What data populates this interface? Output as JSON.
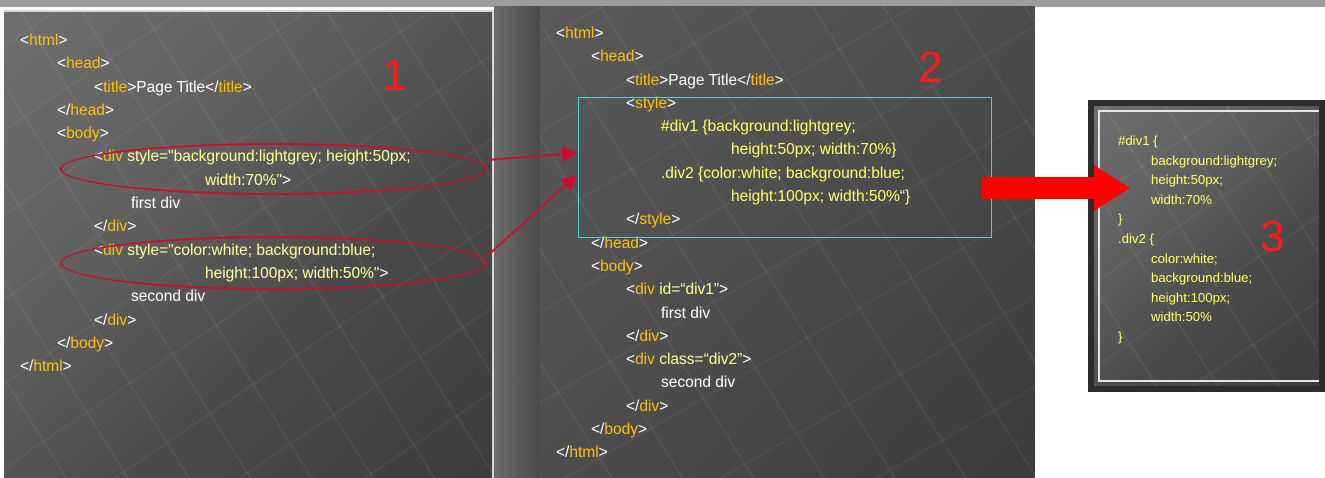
{
  "panel1": {
    "number": "1",
    "lines": [
      {
        "indent": 0,
        "parts": [
          {
            "cls": "txt",
            "t": "<"
          },
          {
            "cls": "tag",
            "t": "html"
          },
          {
            "cls": "txt",
            "t": ">"
          }
        ]
      },
      {
        "indent": 1,
        "parts": [
          {
            "cls": "txt",
            "t": "<"
          },
          {
            "cls": "tag",
            "t": "head"
          },
          {
            "cls": "txt",
            "t": ">"
          }
        ]
      },
      {
        "indent": 2,
        "parts": [
          {
            "cls": "txt",
            "t": "<"
          },
          {
            "cls": "tag",
            "t": "title"
          },
          {
            "cls": "txt",
            "t": ">Page Title</"
          },
          {
            "cls": "tag",
            "t": "title"
          },
          {
            "cls": "txt",
            "t": ">"
          }
        ]
      },
      {
        "indent": 1,
        "parts": [
          {
            "cls": "txt",
            "t": "</"
          },
          {
            "cls": "tag",
            "t": "head"
          },
          {
            "cls": "txt",
            "t": ">"
          }
        ]
      },
      {
        "indent": 1,
        "parts": [
          {
            "cls": "txt",
            "t": "<"
          },
          {
            "cls": "tag",
            "t": "body"
          },
          {
            "cls": "txt",
            "t": ">"
          }
        ]
      },
      {
        "indent": 2,
        "parts": [
          {
            "cls": "txt",
            "t": "<"
          },
          {
            "cls": "tag",
            "t": "div"
          },
          {
            "cls": "attr",
            "t": " style=\"background:lightgrey; height:50px;"
          }
        ]
      },
      {
        "indent": 5,
        "parts": [
          {
            "cls": "attr",
            "t": "width:70%\""
          },
          {
            "cls": "txt",
            "t": ">"
          }
        ]
      },
      {
        "indent": 3,
        "parts": [
          {
            "cls": "txt",
            "t": "first div"
          }
        ]
      },
      {
        "indent": 2,
        "parts": [
          {
            "cls": "txt",
            "t": "</"
          },
          {
            "cls": "tag",
            "t": "div"
          },
          {
            "cls": "txt",
            "t": ">"
          }
        ]
      },
      {
        "indent": 2,
        "parts": [
          {
            "cls": "txt",
            "t": "<"
          },
          {
            "cls": "tag",
            "t": "div"
          },
          {
            "cls": "attr",
            "t": " style=\"color:white; background:blue;"
          }
        ]
      },
      {
        "indent": 5,
        "parts": [
          {
            "cls": "attr",
            "t": "height:100px; width:50%\""
          },
          {
            "cls": "txt",
            "t": ">"
          }
        ]
      },
      {
        "indent": 3,
        "parts": [
          {
            "cls": "txt",
            "t": "second div"
          }
        ]
      },
      {
        "indent": 2,
        "parts": [
          {
            "cls": "txt",
            "t": "</"
          },
          {
            "cls": "tag",
            "t": "div"
          },
          {
            "cls": "txt",
            "t": ">"
          }
        ]
      },
      {
        "indent": 1,
        "parts": [
          {
            "cls": "txt",
            "t": "</"
          },
          {
            "cls": "tag",
            "t": "body"
          },
          {
            "cls": "txt",
            "t": ">"
          }
        ]
      },
      {
        "indent": 0,
        "parts": [
          {
            "cls": "txt",
            "t": "</"
          },
          {
            "cls": "tag",
            "t": "html"
          },
          {
            "cls": "txt",
            "t": ">"
          }
        ]
      }
    ]
  },
  "panel2": {
    "number": "2",
    "lines": [
      {
        "indent": 0,
        "parts": [
          {
            "cls": "txt",
            "t": "<"
          },
          {
            "cls": "tag",
            "t": "html"
          },
          {
            "cls": "txt",
            "t": ">"
          }
        ]
      },
      {
        "indent": 1,
        "parts": [
          {
            "cls": "txt",
            "t": "<"
          },
          {
            "cls": "tag",
            "t": "head"
          },
          {
            "cls": "txt",
            "t": ">"
          }
        ]
      },
      {
        "indent": 2,
        "parts": [
          {
            "cls": "txt",
            "t": "<"
          },
          {
            "cls": "tag",
            "t": "title"
          },
          {
            "cls": "txt",
            "t": ">Page Title</"
          },
          {
            "cls": "tag",
            "t": "title"
          },
          {
            "cls": "txt",
            "t": ">"
          }
        ]
      },
      {
        "indent": 2,
        "parts": [
          {
            "cls": "txt",
            "t": "<"
          },
          {
            "cls": "tag",
            "t": "style"
          },
          {
            "cls": "txt",
            "t": ">"
          }
        ]
      },
      {
        "indent": 3,
        "parts": [
          {
            "cls": "css",
            "t": "#div1 {background:lightgrey;"
          }
        ]
      },
      {
        "indent": 5,
        "parts": [
          {
            "cls": "css",
            "t": "height:50px; width:70%}"
          }
        ]
      },
      {
        "indent": 3,
        "parts": [
          {
            "cls": "css",
            "t": ".div2 {color:white; background:blue;"
          }
        ]
      },
      {
        "indent": 5,
        "parts": [
          {
            "cls": "css",
            "t": "height:100px; width:50%“}"
          }
        ]
      },
      {
        "indent": 2,
        "parts": [
          {
            "cls": "txt",
            "t": "</"
          },
          {
            "cls": "tag",
            "t": "style"
          },
          {
            "cls": "txt",
            "t": ">"
          }
        ]
      },
      {
        "indent": 1,
        "parts": [
          {
            "cls": "txt",
            "t": "</"
          },
          {
            "cls": "tag",
            "t": "head"
          },
          {
            "cls": "txt",
            "t": ">"
          }
        ]
      },
      {
        "indent": 1,
        "parts": [
          {
            "cls": "txt",
            "t": "<"
          },
          {
            "cls": "tag",
            "t": "body"
          },
          {
            "cls": "txt",
            "t": ">"
          }
        ]
      },
      {
        "indent": 2,
        "parts": [
          {
            "cls": "txt",
            "t": "<"
          },
          {
            "cls": "tag",
            "t": "div"
          },
          {
            "cls": "attr",
            "t": " id=“div1”"
          },
          {
            "cls": "txt",
            "t": ">"
          }
        ]
      },
      {
        "indent": 3,
        "parts": [
          {
            "cls": "txt",
            "t": "first div"
          }
        ]
      },
      {
        "indent": 2,
        "parts": [
          {
            "cls": "txt",
            "t": "</"
          },
          {
            "cls": "tag",
            "t": "div"
          },
          {
            "cls": "txt",
            "t": ">"
          }
        ]
      },
      {
        "indent": 2,
        "parts": [
          {
            "cls": "txt",
            "t": "<"
          },
          {
            "cls": "tag",
            "t": "div"
          },
          {
            "cls": "attr",
            "t": " class=“div2”"
          },
          {
            "cls": "txt",
            "t": ">"
          }
        ]
      },
      {
        "indent": 3,
        "parts": [
          {
            "cls": "txt",
            "t": "second div"
          }
        ]
      },
      {
        "indent": 2,
        "parts": [
          {
            "cls": "txt",
            "t": "</"
          },
          {
            "cls": "tag",
            "t": "div"
          },
          {
            "cls": "txt",
            "t": ">"
          }
        ]
      },
      {
        "indent": 1,
        "parts": [
          {
            "cls": "txt",
            "t": "</"
          },
          {
            "cls": "tag",
            "t": "body"
          },
          {
            "cls": "txt",
            "t": ">"
          }
        ]
      },
      {
        "indent": 0,
        "parts": [
          {
            "cls": "txt",
            "t": "</"
          },
          {
            "cls": "tag",
            "t": "html"
          },
          {
            "cls": "txt",
            "t": ">"
          }
        ]
      }
    ]
  },
  "panel3": {
    "number": "3",
    "lines": [
      {
        "indent": 0,
        "parts": [
          {
            "cls": "css",
            "t": "#div1 {"
          }
        ]
      },
      {
        "indent": 1,
        "parts": [
          {
            "cls": "css",
            "t": "background:lightgrey;"
          }
        ]
      },
      {
        "indent": 1,
        "parts": [
          {
            "cls": "css",
            "t": "height:50px;"
          }
        ]
      },
      {
        "indent": 1,
        "parts": [
          {
            "cls": "css",
            "t": "width:70%"
          }
        ]
      },
      {
        "indent": 0,
        "parts": [
          {
            "cls": "css",
            "t": "}"
          }
        ]
      },
      {
        "indent": 0,
        "parts": [
          {
            "cls": "css",
            "t": ".div2 {"
          }
        ]
      },
      {
        "indent": 1,
        "parts": [
          {
            "cls": "css",
            "t": "color:white;"
          }
        ]
      },
      {
        "indent": 1,
        "parts": [
          {
            "cls": "css",
            "t": "background:blue;"
          }
        ]
      },
      {
        "indent": 1,
        "parts": [
          {
            "cls": "css",
            "t": "height:100px;"
          }
        ]
      },
      {
        "indent": 1,
        "parts": [
          {
            "cls": "css",
            "t": "width:50%"
          }
        ]
      },
      {
        "indent": 0,
        "parts": [
          {
            "cls": "css",
            "t": "}"
          }
        ]
      }
    ]
  },
  "colors": {
    "tag": "#ffc000",
    "attribute": "#ffff99",
    "css_rule": "#ffff66",
    "plain_text": "#ffffff",
    "annotation_red": "#ff1a1a",
    "ellipse_red": "#c8102e",
    "style_box_cyan": "#4dd0d8"
  },
  "icons": [
    "red-right-arrow-icon",
    "connector-arrow-icon"
  ]
}
